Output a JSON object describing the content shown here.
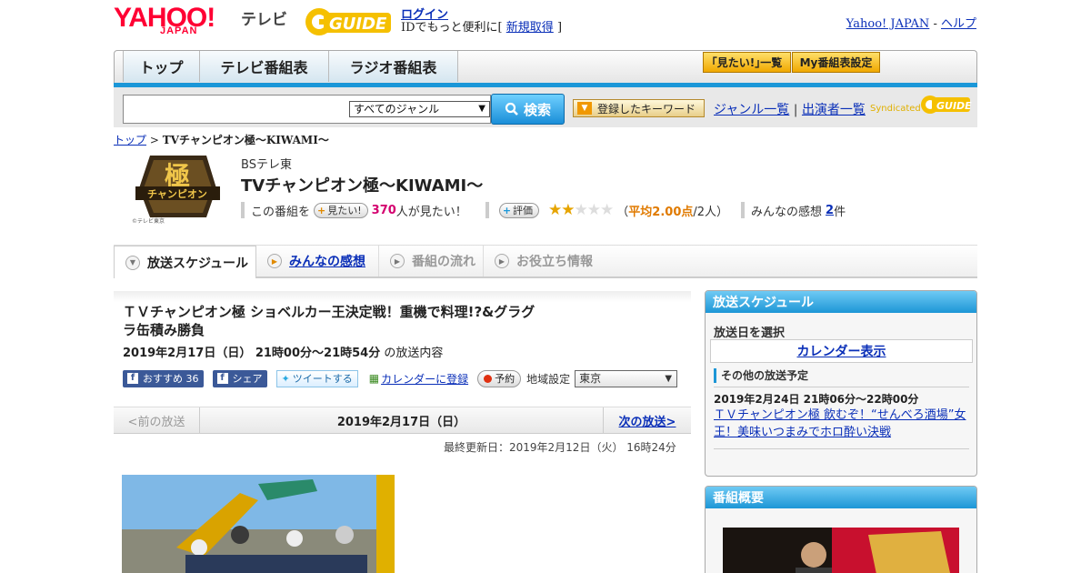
{
  "header": {
    "logo_yahoo": "YAHOO!",
    "logo_japan": "JAPAN",
    "logo_tv": "テレビ",
    "logo_gguide": "GUIDE",
    "login": "ログイン",
    "login_sub": "IDでもっと便利に[",
    "signup": "新規取得",
    "login_sub_end": "]",
    "yahoo_japan": "Yahoo! JAPAN",
    "sep": "-",
    "help": "ヘルプ"
  },
  "nav": {
    "tabs": [
      "トップ",
      "テレビ番組表",
      "ラジオ番組表"
    ],
    "mitai_list": "｢見たい!｣一覧",
    "my_table": "My番組表設定"
  },
  "search": {
    "genre": "すべてのジャンル",
    "button": "検索",
    "keyword_button": "登録したキーワード",
    "genre_list": "ジャンル一覧",
    "divider": "|",
    "performer_list": "出演者一覧",
    "syndicated": "Syndicated"
  },
  "breadcrumb": {
    "top": "トップ",
    "sep": ">",
    "current": "TVチャンピオン極～KIWAMI～"
  },
  "program": {
    "logo_text": "極",
    "logo_sub": "チャンピオン",
    "logo_copy": "©テレビ東京",
    "channel": "BSテレ東",
    "title": "TVチャンピオン極～KIWAMI～",
    "this_program": "この番組を",
    "mitai_button": "見たい!",
    "mitai_count": "370",
    "mitai_suffix": "人が見たい！",
    "rating_button": "評価",
    "rating": 2,
    "rating_max": 5,
    "rating_open": "（",
    "avg_label": "平均2.00点",
    "avg_suffix": "/2人）",
    "reviews_label": "みんなの感想",
    "reviews_count": "2",
    "reviews_suffix": "件"
  },
  "sections": [
    "放送スケジュール",
    "みんなの感想",
    "番組の流れ",
    "お役立ち情報"
  ],
  "episode": {
    "title": "ＴＶチャンピオン極 ショベルカー王決定戦！重機で料理!?&グラグラ缶積み勝負",
    "date": "2019年2月17日（日） 21時00分～21時54分",
    "date_suffix": "の放送内容",
    "fb_recommend": "おすすめ",
    "fb_count": "36",
    "fb_share": "シェア",
    "tweet": "ツイートする",
    "calendar": "カレンダーに登録",
    "reserve": "予約",
    "region_label": "地域設定",
    "region": "東京",
    "prev": "<前の放送",
    "current_date": "2019年2月17日（日）",
    "next": "次の放送>",
    "updated": "最終更新日：2019年2月12日（火） 16時24分"
  },
  "sidebar": {
    "schedule_title": "放送スケジュール",
    "select_date": "放送日を選択",
    "calendar_view": "カレンダー表示",
    "other_schedule": "その他の放送予定",
    "other_date": "2019年2月24日 21時06分～22時00分",
    "other_title": "ＴＶチャンピオン極 飲むぞ！“せんべろ酒場”女王！美味いつまみでホロ酔い決戦",
    "summary_title": "番組概要"
  },
  "colors": {
    "accent_blue": "#1b97d8",
    "link": "#0a2fb8",
    "yahoo_red": "#ff0033",
    "star": "#e6a400"
  }
}
